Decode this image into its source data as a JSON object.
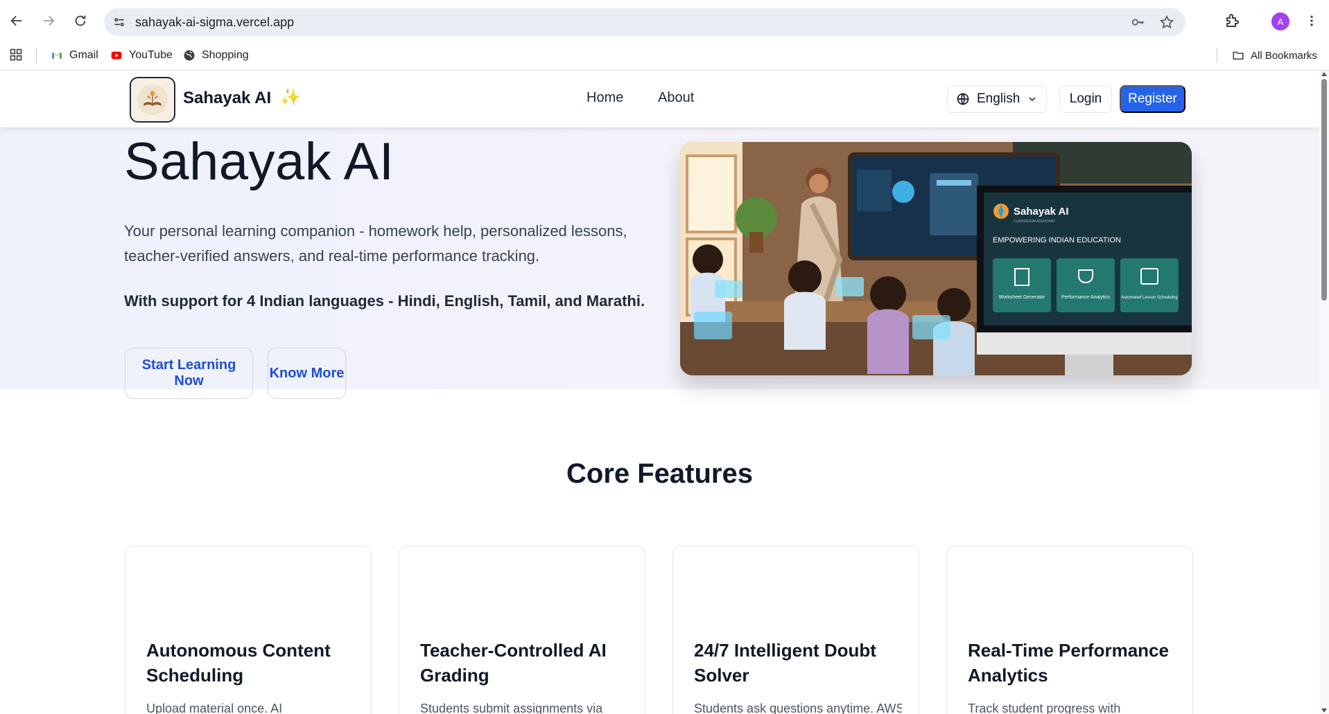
{
  "browser": {
    "url": "sahayak-ai-sigma.vercel.app",
    "profile_initial": "A",
    "bookmarks": [
      {
        "label": "Gmail",
        "icon": "gmail-icon"
      },
      {
        "label": "YouTube",
        "icon": "youtube-icon"
      },
      {
        "label": "Shopping",
        "icon": "globe-icon"
      }
    ],
    "all_bookmarks": "All Bookmarks"
  },
  "header": {
    "brand": "Sahayak AI",
    "nav": [
      "Home",
      "About"
    ],
    "language": "English",
    "login": "Login",
    "register": "Register",
    "accent_color": "#2563eb"
  },
  "hero": {
    "title": "Sahayak AI",
    "description": "Your personal learning companion - homework help, personalized lessons, teacher-verified answers, and real-time performance tracking.",
    "languages": "With support for 4 Indian languages - Hindi, English, Tamil, and Marathi.",
    "primary_button": "Start Learning Now",
    "secondary_button": "Know More",
    "image": {
      "monitor_brand": "Sahayak AI",
      "monitor_subtitle": "CLASSROOM ASSISTANT",
      "monitor_heading": "EMPOWERING INDIAN EDUCATION",
      "tiles": [
        "Worksheet Generator",
        "Performance Analytics",
        "Automated Lesson Scheduling"
      ]
    }
  },
  "features": {
    "title": "Core Features",
    "cards": [
      {
        "title": "Autonomous Content Scheduling",
        "desc": "Upload material once. AI"
      },
      {
        "title": "Teacher-Controlled AI Grading",
        "desc": "Students submit assignments via"
      },
      {
        "title": "24/7 Intelligent Doubt Solver",
        "desc": "Students ask questions anytime. AWS"
      },
      {
        "title": "Real-Time Performance Analytics",
        "desc": "Track student progress with"
      }
    ]
  }
}
